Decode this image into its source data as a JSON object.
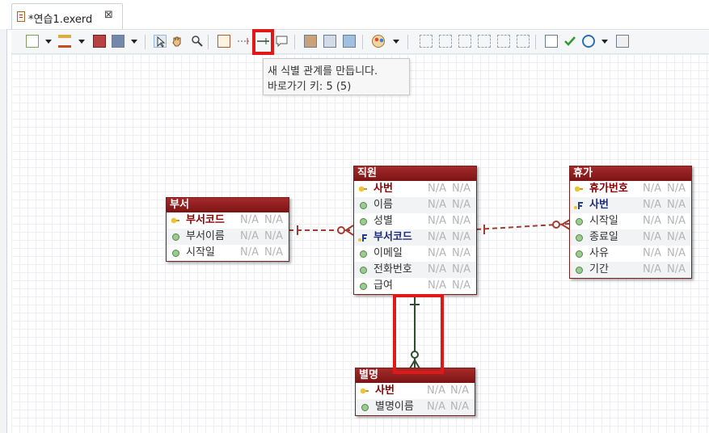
{
  "tab": {
    "title": "*연습1.exerd"
  },
  "tooltip": {
    "line1": "새 식별 관계를 만듭니다.",
    "line2": "바로가기 키: 5 (5)"
  },
  "colors": {
    "header": "#8b1a1a",
    "pk_text": "#8b0000",
    "fk_text": "#1d2e7a",
    "relation_dashed": "#a33b2f",
    "relation_identifying": "#2f4f2f",
    "highlight": "#e01818"
  },
  "entities": [
    {
      "id": "dept",
      "title": "부서",
      "attrs": [
        {
          "name": "부서코드",
          "kind": "pk",
          "v1": "N/A",
          "v2": "N/A"
        },
        {
          "name": "부서이름",
          "kind": "attr",
          "v1": "N/A",
          "v2": "N/A"
        },
        {
          "name": "시작일",
          "kind": "attr",
          "v1": "N/A",
          "v2": "N/A"
        }
      ]
    },
    {
      "id": "emp",
      "title": "직원",
      "attrs": [
        {
          "name": "사번",
          "kind": "pk",
          "v1": "N/A",
          "v2": "N/A"
        },
        {
          "name": "이름",
          "kind": "attr",
          "v1": "N/A",
          "v2": "N/A"
        },
        {
          "name": "성별",
          "kind": "attr",
          "v1": "N/A",
          "v2": "N/A"
        },
        {
          "name": "부서코드",
          "kind": "fk",
          "v1": "N/A",
          "v2": "N/A"
        },
        {
          "name": "이메일",
          "kind": "attr",
          "v1": "N/A",
          "v2": "N/A"
        },
        {
          "name": "전화번호",
          "kind": "attr",
          "v1": "N/A",
          "v2": "N/A"
        },
        {
          "name": "급여",
          "kind": "attr",
          "v1": "N/A",
          "v2": "N/A"
        }
      ]
    },
    {
      "id": "leave",
      "title": "휴가",
      "attrs": [
        {
          "name": "휴가번호",
          "kind": "pk",
          "v1": "N/A",
          "v2": "N/A"
        },
        {
          "name": "사번",
          "kind": "fk",
          "v1": "N/A",
          "v2": "N/A"
        },
        {
          "name": "시작일",
          "kind": "attr",
          "v1": "N/A",
          "v2": "N/A"
        },
        {
          "name": "종료일",
          "kind": "attr",
          "v1": "N/A",
          "v2": "N/A"
        },
        {
          "name": "사유",
          "kind": "attr",
          "v1": "N/A",
          "v2": "N/A"
        },
        {
          "name": "기간",
          "kind": "attr",
          "v1": "N/A",
          "v2": "N/A"
        }
      ]
    },
    {
      "id": "nick",
      "title": "별명",
      "attrs": [
        {
          "name": "사번",
          "kind": "pkfk",
          "v1": "N/A",
          "v2": "N/A"
        },
        {
          "name": "별명이름",
          "kind": "attr",
          "v1": "N/A",
          "v2": "N/A"
        }
      ]
    }
  ]
}
